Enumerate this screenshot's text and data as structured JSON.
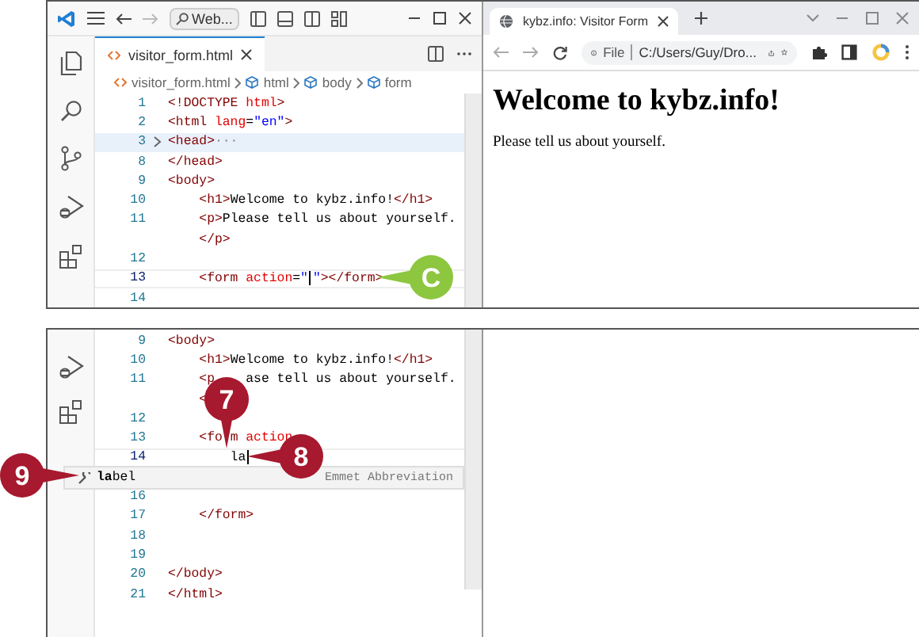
{
  "top": {
    "editor": {
      "title_bar": {
        "search": "Web..."
      },
      "tab": {
        "label": "visitor_form.html",
        "selected": true
      },
      "breadcrumb": [
        "visitor_form.html",
        "html",
        "body",
        "form"
      ],
      "lines": [
        {
          "num": "1",
          "current": false,
          "folded": false,
          "tokens": [
            {
              "kind": "tag",
              "t": "<!DOCTYPE "
            },
            {
              "kind": "attr",
              "t": "html"
            },
            {
              "kind": "tag",
              "t": ">"
            }
          ]
        },
        {
          "num": "2",
          "current": false,
          "folded": false,
          "tokens": [
            {
              "kind": "tag",
              "t": "<html "
            },
            {
              "kind": "attr",
              "t": "lang"
            },
            {
              "kind": "text",
              "t": "="
            },
            {
              "kind": "str",
              "t": "\"en\""
            },
            {
              "kind": "tag",
              "t": ">"
            }
          ]
        },
        {
          "num": "3",
          "current": false,
          "folded": true,
          "tokens": [
            {
              "kind": "tag",
              "t": "<head>"
            },
            {
              "kind": "fold",
              "t": "···"
            }
          ]
        },
        {
          "num": "8",
          "current": false,
          "folded": false,
          "tokens": [
            {
              "kind": "tag",
              "t": "</head>"
            }
          ]
        },
        {
          "num": "9",
          "current": false,
          "folded": false,
          "tokens": [
            {
              "kind": "tag",
              "t": "<body>"
            }
          ]
        },
        {
          "num": "10",
          "current": false,
          "folded": false,
          "tokens": [
            {
              "kind": "tag",
              "t": "    <h1>"
            },
            {
              "kind": "text",
              "t": "Welcome to kybz.info!"
            },
            {
              "kind": "tag",
              "t": "</h1>"
            }
          ]
        },
        {
          "num": "11",
          "current": false,
          "folded": false,
          "tokens": [
            {
              "kind": "tag",
              "t": "    <p>"
            },
            {
              "kind": "text",
              "t": "Please tell us about yourself."
            }
          ]
        },
        {
          "current": false,
          "folded": false,
          "tokens": [
            {
              "kind": "tag",
              "t": "    </p>"
            }
          ]
        },
        {
          "num": "12",
          "current": false,
          "folded": false
        },
        {
          "num": "13",
          "current": true,
          "folded": false,
          "tokens": [
            {
              "kind": "tag",
              "t": "    <form "
            },
            {
              "kind": "attr",
              "t": "action"
            },
            {
              "kind": "text",
              "t": "="
            },
            {
              "kind": "str",
              "t": "\""
            },
            {
              "kind": "cursor"
            },
            {
              "kind": "str",
              "t": "\""
            },
            {
              "kind": "tag",
              "t": "></form>"
            }
          ]
        },
        {
          "num": "14",
          "current": false,
          "folded": false
        }
      ]
    },
    "browser": {
      "tab": {
        "label": "kybz.info: Visitor Form",
        "selected": true
      },
      "scheme": "File",
      "address": "C:/Users/Guy/Dro...",
      "heading": "Welcome to kybz.info!",
      "paragraph": "Please tell us about yourself."
    },
    "callouts": [
      {
        "label": "C",
        "color": "#8dc63f"
      }
    ]
  },
  "bottom": {
    "editor": {
      "lines": [
        {
          "num": "9",
          "current": false,
          "folded": false,
          "tokens": [
            {
              "kind": "tag",
              "t": "<body>"
            }
          ]
        },
        {
          "num": "10",
          "current": false,
          "folded": false,
          "tokens": [
            {
              "kind": "tag",
              "t": "    <h1>"
            },
            {
              "kind": "text",
              "t": "Welcome to kybz.info!"
            },
            {
              "kind": "tag",
              "t": "</h1>"
            }
          ]
        },
        {
          "num": "11",
          "current": false,
          "folded": false,
          "tokens": [
            {
              "kind": "tag",
              "t": "    <p"
            },
            {
              "kind": "gap4"
            },
            {
              "kind": "text",
              "t": "ase tell us about yourself."
            }
          ]
        },
        {
          "current": false,
          "folded": false,
          "tokens": [
            {
              "kind": "tag",
              "t": "    <"
            }
          ]
        },
        {
          "num": "12",
          "current": false,
          "folded": false
        },
        {
          "num": "13",
          "current": false,
          "folded": false,
          "tokens": [
            {
              "kind": "tag",
              "t": "    <fo"
            },
            {
              "kind": "gap1"
            },
            {
              "kind": "tag",
              "t": "m "
            },
            {
              "kind": "attr",
              "t": "action"
            }
          ]
        },
        {
          "num": "14",
          "current": true,
          "folded": false,
          "tokens": [
            {
              "kind": "text",
              "t": "        la"
            },
            {
              "kind": "cursor"
            }
          ]
        },
        {
          "num": "16",
          "current": false,
          "folded": false
        },
        {
          "num": "17",
          "current": false,
          "folded": false,
          "tokens": [
            {
              "kind": "tag",
              "t": "    </form>"
            }
          ]
        },
        {
          "num": "18",
          "current": false,
          "folded": false
        },
        {
          "num": "19",
          "current": false,
          "folded": false
        },
        {
          "num": "20",
          "current": false,
          "folded": false,
          "tokens": [
            {
              "kind": "tag",
              "t": "</body>"
            }
          ]
        },
        {
          "num": "21",
          "current": false,
          "folded": false,
          "tokens": [
            {
              "kind": "tag",
              "t": "</html>"
            }
          ]
        }
      ],
      "suggestion": {
        "label": "**la**bel",
        "detail": "Emmet Abbreviation"
      }
    },
    "callouts": [
      {
        "label": "7",
        "color": "#a6192e"
      },
      {
        "label": "8",
        "color": "#a6192e"
      },
      {
        "label": "9",
        "color": "#a6192e"
      }
    ]
  }
}
